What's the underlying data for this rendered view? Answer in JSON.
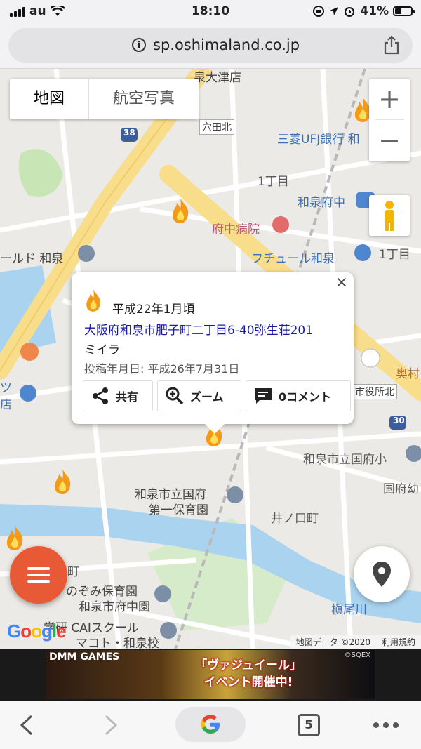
{
  "status_bar": {
    "carrier": "au",
    "time": "18:10",
    "battery": "41%",
    "battery_level": 0.41
  },
  "browser": {
    "url": "sp.oshimaland.co.jp",
    "tab_count": "5"
  },
  "map": {
    "type_buttons": [
      "地図",
      "航空写真"
    ],
    "zoom_in": "+",
    "zoom_out": "−",
    "labels": {
      "izumiotsu": "泉大津店",
      "anadakita": "穴田北",
      "route38": "38",
      "mufg": "三菱UFJ銀行 和",
      "chome1a": "1丁目",
      "izumifuchu_station": "和泉府中",
      "fuchu_hospital": "府中病院",
      "world_izumi": "ールド 和泉",
      "fchuru": "フチュール和泉",
      "chome1b": "1丁目",
      "okumura": "奥村",
      "shiyakusho": "市役所北",
      "route30": "30",
      "kokufu_elem": "和泉市立国府小",
      "kokufu_nursery_1": "和泉市立国府",
      "kokufu_nursery_2": "第一保育園",
      "kokufu_kindergarten": "国府幼",
      "inoguchi": "井ノ口町",
      "nozomi_nursery": "のぞみ保育園",
      "izumi_chu": "和泉市府中園",
      "cai_school": "学研 CAIスクール",
      "makoto_izumi": "マコト・和泉校",
      "makiogawa": "槇尾川",
      "machi": "町",
      "tsu_store": "ツ",
      "ten": "店"
    },
    "google_logo": "Google",
    "attribution": "地図データ ©2020",
    "terms": "利用規約"
  },
  "popup": {
    "close": "×",
    "date": "平成22年1月頃",
    "address": "大阪府和泉市肥子町二丁目6-40弥生荘201",
    "name": "ミイラ",
    "posted": "投稿年月日: 平成26年7月31日",
    "share_label": "共有",
    "zoom_label": "ズーム",
    "comment_label": "0コメント"
  },
  "ad": {
    "brand": "DMM GAMES",
    "copyright": "©SQEX",
    "promo_line1": "「ヴァジュイール」",
    "promo_line2": "イベント開催中!"
  },
  "icons": [
    "info-icon",
    "share-icon",
    "fire-icon",
    "zoom-icon",
    "comment-icon",
    "menu-icon",
    "location-pin-icon",
    "pegman-icon",
    "back-icon",
    "forward-icon",
    "google-icon",
    "more-icon"
  ],
  "colors": {
    "fab": "#e85a35",
    "link": "#1a1aa6",
    "road_major": "#f8dd8a",
    "water": "#aad3f0"
  }
}
